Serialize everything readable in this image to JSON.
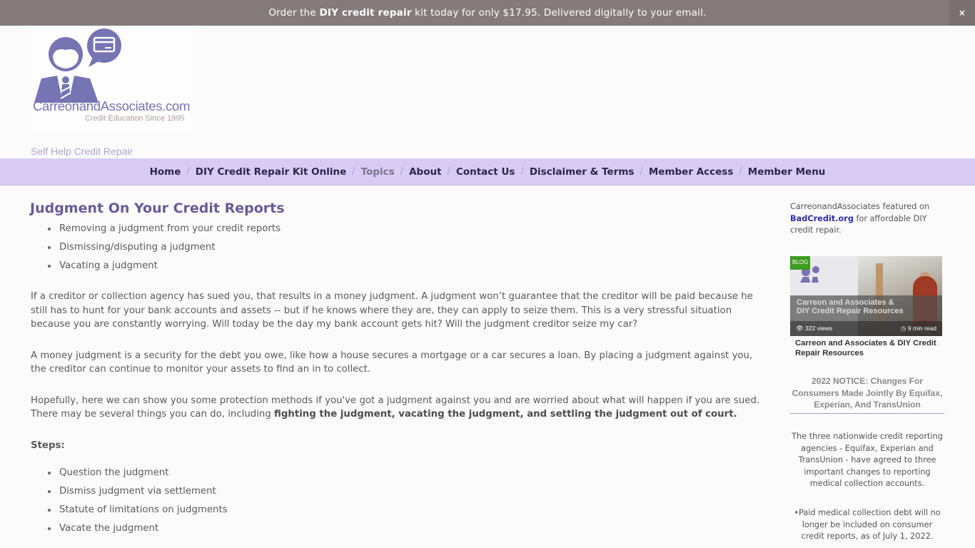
{
  "promo": {
    "pre": "Order the ",
    "bold": "DIY credit repair",
    "post": " kit today for only $17.95. Delivered digitally to your email.",
    "close_label": "×"
  },
  "header": {
    "logo_name": "CarreonandAssociates.com",
    "logo_tagline": "Credit Education Since 1995",
    "site_tagline": "Self Help Credit Repair",
    "brand_color": "#7674b3"
  },
  "nav": {
    "items": [
      {
        "label": "Home"
      },
      {
        "label": "DIY Credit Repair Kit Online"
      },
      {
        "label": "Topics",
        "active": true
      },
      {
        "label": "About"
      },
      {
        "label": "Contact Us"
      },
      {
        "label": "Disclaimer & Terms"
      },
      {
        "label": "Member Access"
      },
      {
        "label": "Member Menu"
      }
    ],
    "separator": "/"
  },
  "article": {
    "title": "Judgment On Your Credit Reports",
    "intro_list": [
      "Removing a judgment from your credit reports",
      "Dismissing/disputing a judgment",
      "Vacating a judgment"
    ],
    "p1": "If a creditor or collection agency has sued you, that results in a money judgment. A judgment won’t guarantee that the creditor will be paid because he still has to hunt for your bank accounts and assets -- but if he knows where they are, they can apply to seize them. This is a very stressful situation because you are constantly worrying. Will today be the day my bank account gets hit? Will the judgment creditor seize my car?",
    "p2": "A money judgment is a security for the debt you owe, like how a house secures a mortgage or a car secures a loan. By placing a judgment against you, the creditor can continue to monitor your assets to find an in to collect.",
    "p3_text": "Hopefully, here we can show you some protection methods if you've got a judgment against you and are worried about what will happen if you are sued. There may be several things you can do, including ",
    "p3_bold": "fighting the judgment, vacating the judgment, and settling the judgment out of court.",
    "steps_label": "Steps:",
    "steps_list": [
      "Question the judgment",
      "Dismiss judgment via settlement",
      "Statute of limitations on judgments",
      "Vacate the judgment"
    ]
  },
  "sidebar": {
    "featured_pre": "CarreonandAssociates featured on ",
    "featured_link": "BadCredit.org",
    "featured_post": " for affordable DIY credit repair.",
    "blog": {
      "badge": "BLOG",
      "overlay_line1": "Carreon and Associates &",
      "overlay_line2": "DIY Credit Repair Resources",
      "views": "322 views",
      "read_time": "9 min read",
      "title": "Carreon and Associates & DIY Credit Repair Resources"
    },
    "notice_title": "2022 NOTICE: Changes For Consumers Made Jointly By Equifax, Experian, And TransUnion",
    "notice_body": "The three nationwide credit reporting agencies - Equifax, Experian and TransUnion - have agreed to three important changes to reporting medical collection accounts.",
    "notice_bullet": "•Paid medical collection debt will no longer be included on consumer credit reports, as of July 1, 2022."
  }
}
